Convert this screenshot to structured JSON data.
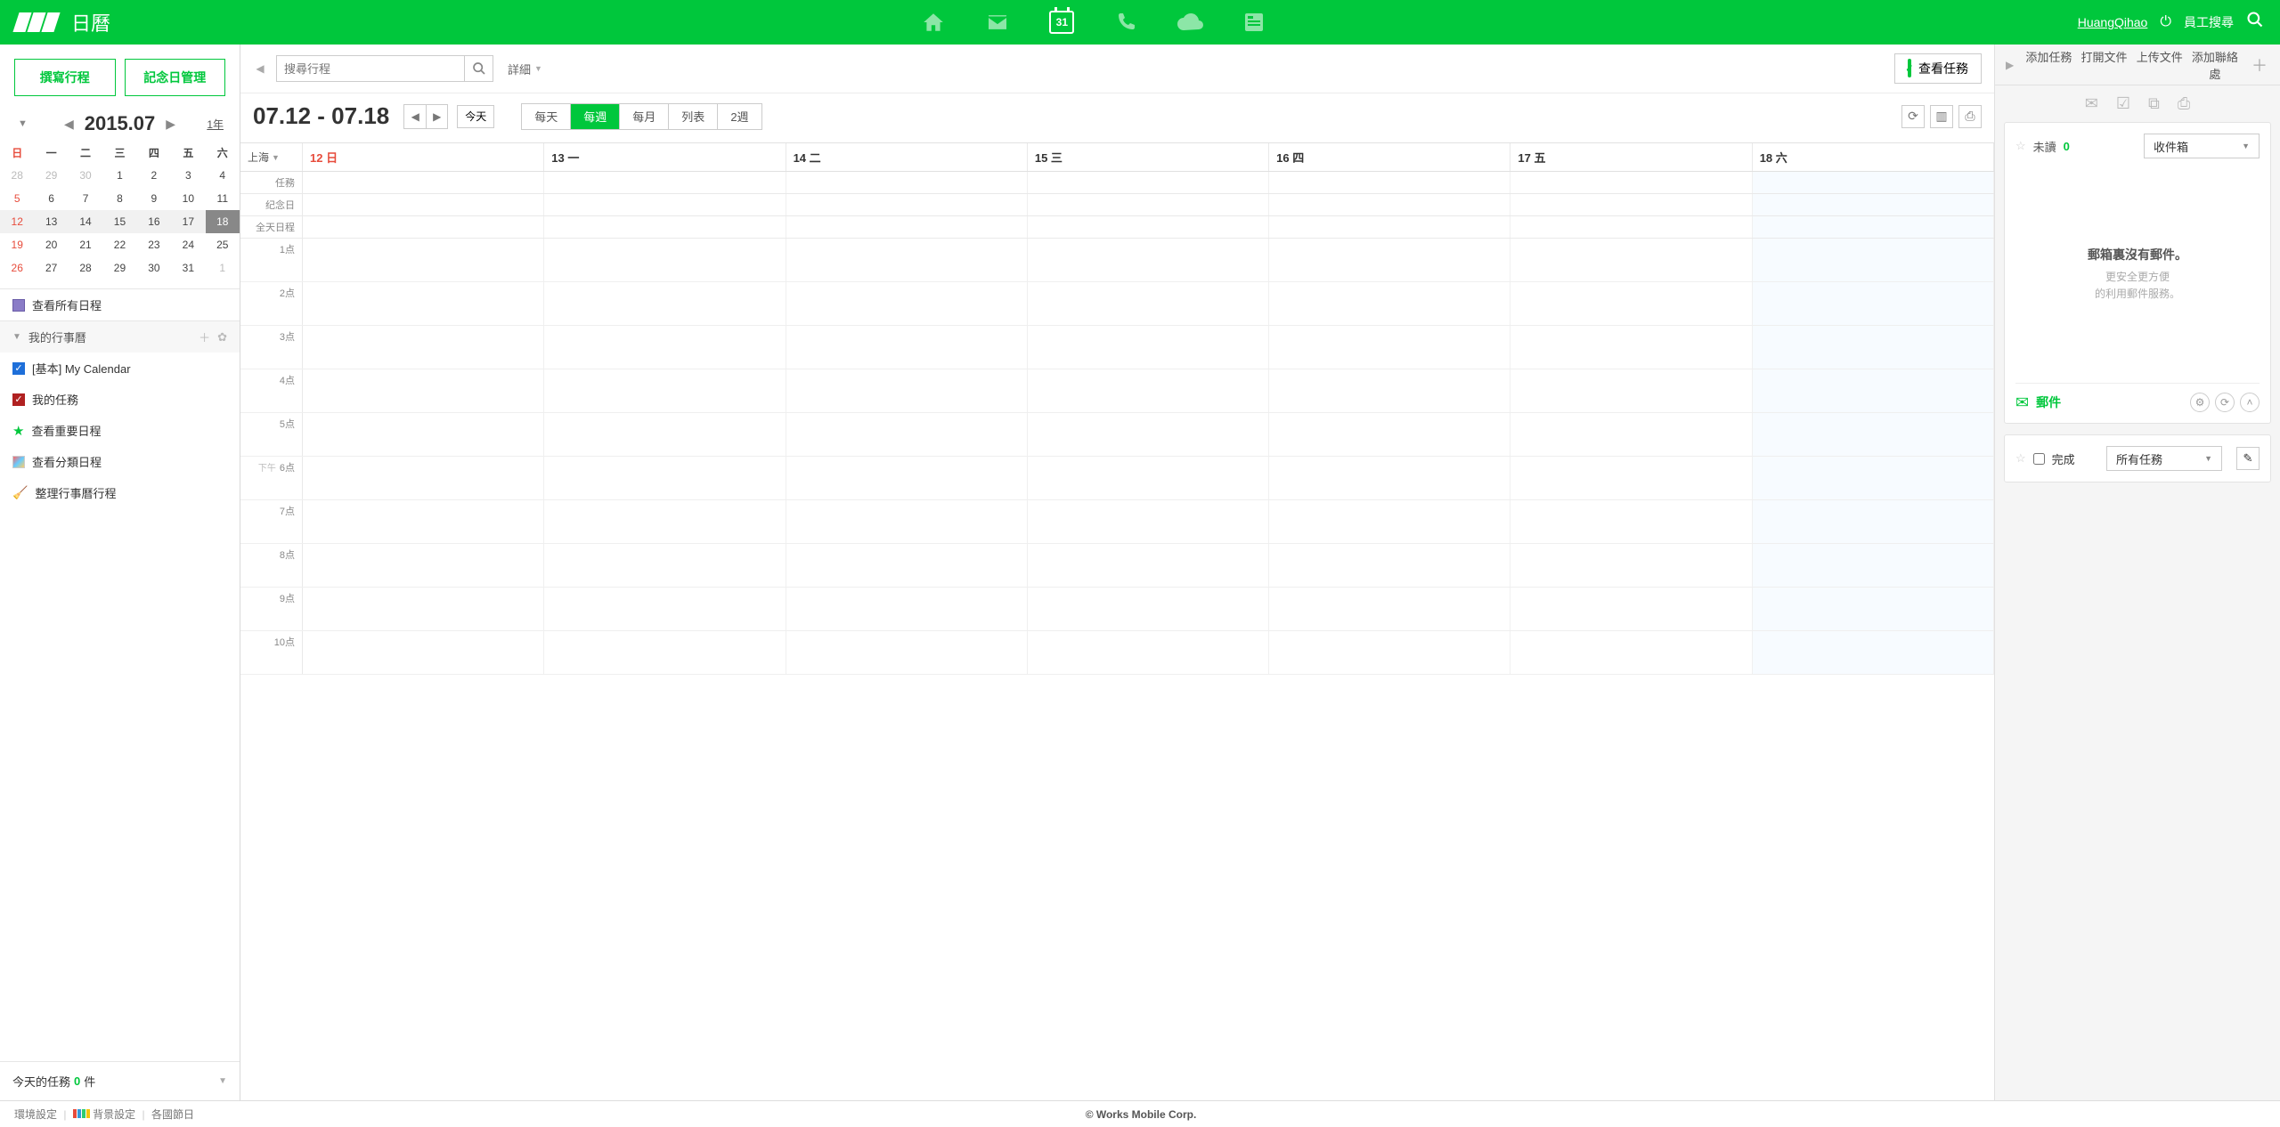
{
  "topbar": {
    "app_title": "日曆",
    "cal_day_num": "31",
    "user_name": "HuangQihao",
    "staff_search": "員工搜尋"
  },
  "sidebar": {
    "compose": "撰寫行程",
    "anniversary": "記念日管理",
    "year_month": "2015.07",
    "one_year": "1年",
    "dow": [
      "日",
      "一",
      "二",
      "三",
      "四",
      "五",
      "六"
    ],
    "weeks": [
      [
        {
          "d": "28",
          "dim": true,
          "sun": true
        },
        {
          "d": "29",
          "dim": true
        },
        {
          "d": "30",
          "dim": true
        },
        {
          "d": "1"
        },
        {
          "d": "2"
        },
        {
          "d": "3"
        },
        {
          "d": "4"
        }
      ],
      [
        {
          "d": "5",
          "sun": true
        },
        {
          "d": "6"
        },
        {
          "d": "7"
        },
        {
          "d": "8"
        },
        {
          "d": "9"
        },
        {
          "d": "10"
        },
        {
          "d": "11"
        }
      ],
      [
        {
          "d": "12",
          "sun": true
        },
        {
          "d": "13"
        },
        {
          "d": "14"
        },
        {
          "d": "15"
        },
        {
          "d": "16"
        },
        {
          "d": "17"
        },
        {
          "d": "18",
          "today": true
        }
      ],
      [
        {
          "d": "19",
          "sun": true
        },
        {
          "d": "20"
        },
        {
          "d": "21"
        },
        {
          "d": "22"
        },
        {
          "d": "23"
        },
        {
          "d": "24"
        },
        {
          "d": "25"
        }
      ],
      [
        {
          "d": "26",
          "sun": true
        },
        {
          "d": "27"
        },
        {
          "d": "28"
        },
        {
          "d": "29"
        },
        {
          "d": "30"
        },
        {
          "d": "31"
        },
        {
          "d": "1",
          "dim": true
        }
      ]
    ],
    "view_all": "查看所有日程",
    "my_cal_header": "我的行事曆",
    "calendars": [
      {
        "label": "[基本] My Calendar",
        "style": "blue"
      },
      {
        "label": "我的任務",
        "style": "red"
      }
    ],
    "important": "查看重要日程",
    "categorized": "查看分類日程",
    "organize": "整理行事曆行程",
    "today_tasks_label": "今天的任務",
    "today_tasks_count": "0",
    "today_tasks_unit": "件"
  },
  "center": {
    "search_placeholder": "搜尋行程",
    "detail": "詳細",
    "view_tasks": "查看任務",
    "range": "07.12 - 07.18",
    "today": "今天",
    "views": [
      "每天",
      "每週",
      "每月",
      "列表",
      "2週"
    ],
    "active_view": 1,
    "timezone": "上海",
    "day_headers": [
      {
        "label": "12 日",
        "sun": true
      },
      {
        "label": "13 一"
      },
      {
        "label": "14 二"
      },
      {
        "label": "15 三"
      },
      {
        "label": "16 四"
      },
      {
        "label": "17 五"
      },
      {
        "label": "18 六",
        "sat": true
      }
    ],
    "allday_rows": [
      "任務",
      "纪念日",
      "全天日程"
    ],
    "hours": [
      {
        "h": "1点"
      },
      {
        "h": "2点"
      },
      {
        "h": "3点"
      },
      {
        "h": "4点"
      },
      {
        "h": "5点"
      },
      {
        "h": "6点",
        "ampm": "下午"
      },
      {
        "h": "7点"
      },
      {
        "h": "8点"
      },
      {
        "h": "9点"
      },
      {
        "h": "10点"
      }
    ]
  },
  "panel": {
    "actions": [
      "添加任務",
      "打開文件",
      "上传文件",
      "添加聯絡處"
    ],
    "mail": {
      "unread_label": "未讀",
      "unread_count": "0",
      "inbox": "收件箱",
      "empty_title": "郵箱裏沒有郵件。",
      "empty_sub1": "更安全更方便",
      "empty_sub2": "的利用郵件服務。",
      "footer_label": "郵件"
    },
    "tasks": {
      "done_label": "完成",
      "filter": "所有任務"
    }
  },
  "footer": {
    "env": "環境設定",
    "bg": "背景設定",
    "holidays": "各國節日",
    "copyright": "© Works Mobile Corp."
  }
}
